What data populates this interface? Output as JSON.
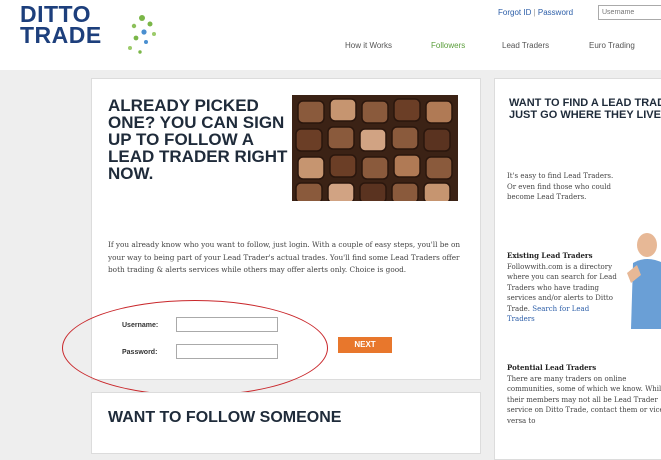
{
  "logo": {
    "line1": "DITTO",
    "line2": "TRADE"
  },
  "login": {
    "forgot": "Forgot ID",
    "password": "Password",
    "username_placeholder": "Username"
  },
  "nav": [
    {
      "label": "How it Works",
      "active": false
    },
    {
      "label": "Followers",
      "active": true
    },
    {
      "label": "Lead Traders",
      "active": false
    },
    {
      "label": "Euro Trading",
      "active": false
    }
  ],
  "left": {
    "headline": "Already picked one? You can sign up to follow a lead trader right now.",
    "intro": "If you already know who you want to follow, just login. With a couple of easy steps, you'll be on your way to being part of your Lead Trader's actual trades. You'll find some Lead Traders offer both trading & alerts services while others may offer alerts only. Choice is good.",
    "username_label": "Username:",
    "password_label": "Password:",
    "next_label": "NEXT"
  },
  "bottom": {
    "headline": "Want to follow someone"
  },
  "right": {
    "headline": "Want to find a lead trader? Just go where they live.",
    "p1": "It's easy to find Lead Traders. Or even find those who could become Lead Traders.",
    "existing_title": "Existing Lead Traders",
    "existing_text": "Followwith.com is a directory where you can search for Lead Traders who have trading services and/or alerts to Ditto Trade.",
    "existing_link": "Search for Lead Traders",
    "potential_title": "Potential Lead Traders",
    "potential_text": "There are many traders on online communities, some of which we know. While their members may not all be Lead Trader service on Ditto Trade, contact them or vice versa to"
  },
  "colors": {
    "brand": "#1d3f7c",
    "accent": "#e8772c",
    "nav_active": "#5a9e3a",
    "highlight": "#c9272b"
  }
}
